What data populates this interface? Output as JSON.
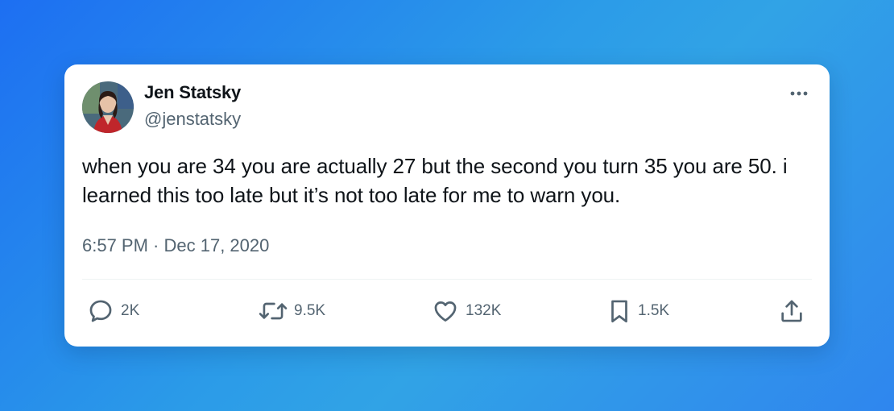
{
  "tweet": {
    "author": {
      "display_name": "Jen Statsky",
      "handle": "@jenstatsky",
      "avatar_icon": "profile-photo"
    },
    "text": "when you are 34 you are actually 27 but the second you turn 35 you are 50. i learned this too late but it’s not too late for me to warn you.",
    "timestamp": "6:57 PM · Dec 17, 2020",
    "more_icon": "more-icon",
    "actions": {
      "replies": {
        "icon": "reply-icon",
        "count": "2K"
      },
      "retweets": {
        "icon": "retweet-icon",
        "count": "9.5K"
      },
      "likes": {
        "icon": "heart-icon",
        "count": "132K"
      },
      "bookmarks": {
        "icon": "bookmark-icon",
        "count": "1.5K"
      },
      "share": {
        "icon": "share-icon"
      }
    }
  },
  "colors": {
    "card_background": "#ffffff",
    "primary_text": "#0f1419",
    "secondary_text": "#536471",
    "background_gradient_start": "#1d6ff2",
    "background_gradient_end": "#2f86ee"
  }
}
